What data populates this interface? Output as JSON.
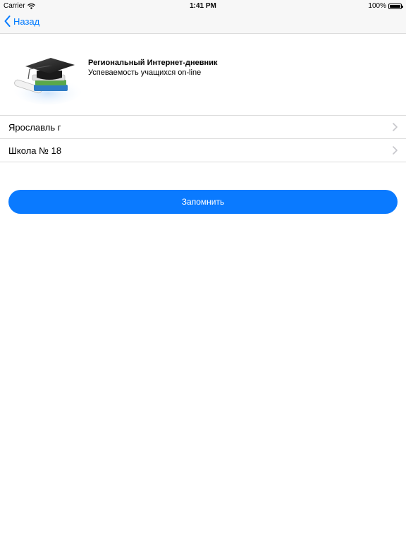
{
  "status_bar": {
    "carrier": "Carrier",
    "time": "1:41 PM",
    "battery": "100%"
  },
  "nav": {
    "back_label": "Назад",
    "accent_color": "#007aff"
  },
  "header": {
    "logo_icon": "graduation-cap-books-icon",
    "title": "Региональный Интернет-дневник",
    "subtitle": "Успеваемость учащихся on-line"
  },
  "list": {
    "items": [
      {
        "label": "Ярославль г"
      },
      {
        "label": "Школа № 18"
      }
    ]
  },
  "actions": {
    "save_label": "Запомнить",
    "button_color": "#0a7aff"
  }
}
